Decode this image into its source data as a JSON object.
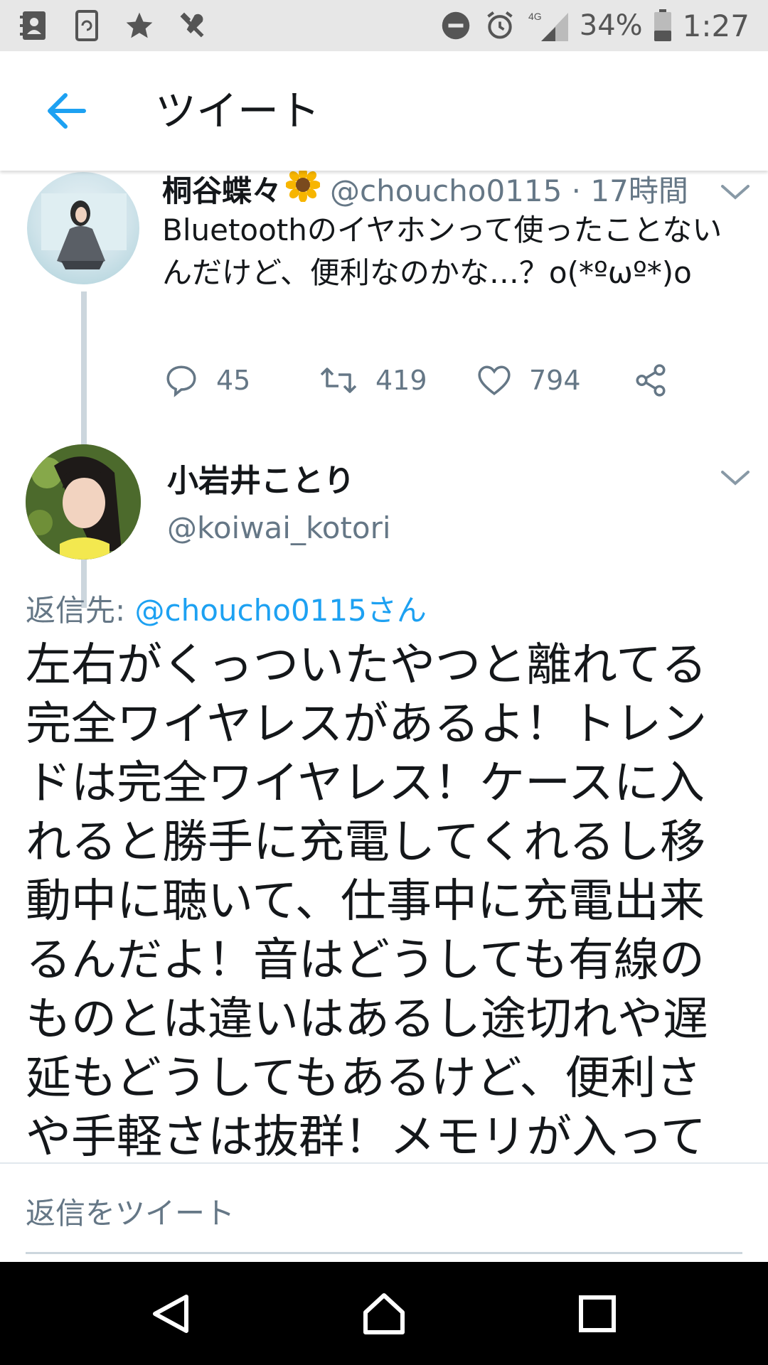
{
  "status_bar": {
    "network": "4G",
    "battery": "34%",
    "time": "1:27"
  },
  "header": {
    "title": "ツイート",
    "back_icon": "arrow-left-icon"
  },
  "parent_tweet": {
    "name": "桐谷蝶々",
    "handle_time": "@choucho0115 · 17時間",
    "text": "Bluetoothのイヤホンって使ったことないんだけど、便利なのかな…？o(*ºωº*)o",
    "replies": "45",
    "retweets": "419",
    "likes": "794"
  },
  "main_tweet": {
    "name": "小岩井ことり",
    "handle": "@koiwai_kotori",
    "reply_label": "返信先: ",
    "reply_mention": "@choucho0115さん",
    "text": "左右がくっついたやつと離れてる完全ワイヤレスがあるよ！トレンドは完全ワイヤレス！ケースに入れると勝手に充電してくれるし移動中に聴いて、仕事中に充電出来るんだよ！音はどうしても有線のものとは違いはあるし途切れや遅延もどうしてもあるけど、便利さや手軽さは抜群！メモリが入って"
  },
  "reply_bar": {
    "placeholder": "返信をツイート"
  },
  "colors": {
    "accent": "#1da1f2",
    "secondary_text": "#657786",
    "status_bar_bg": "#e7e7e7"
  }
}
